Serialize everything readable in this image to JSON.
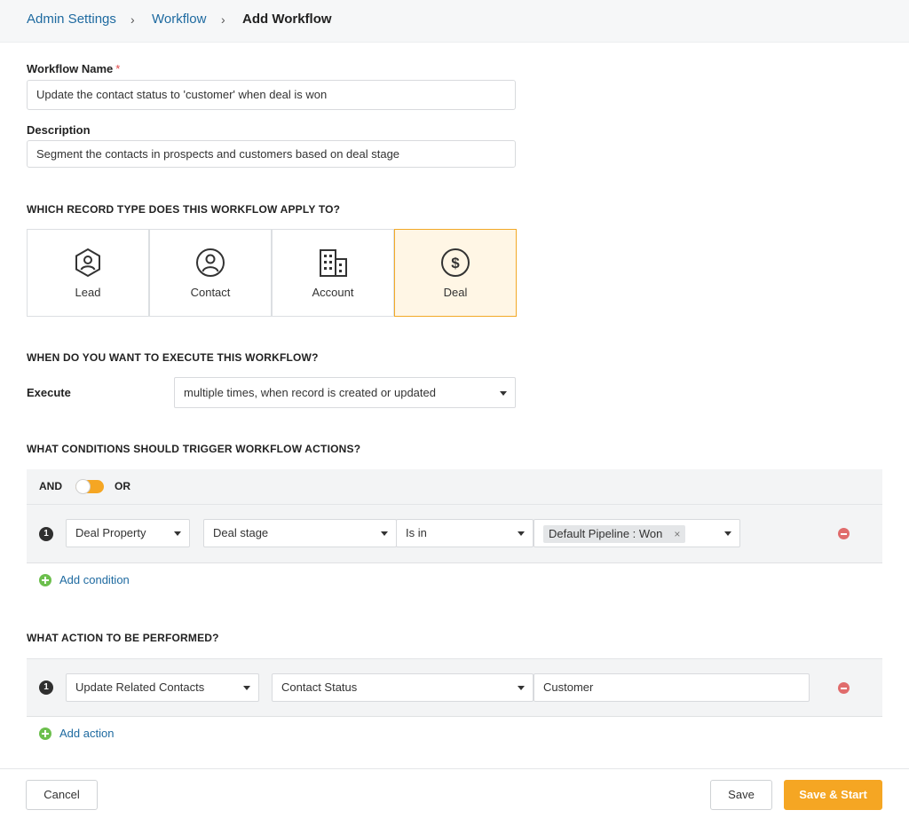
{
  "breadcrumb": {
    "items": [
      "Admin Settings",
      "Workflow",
      "Add Workflow"
    ]
  },
  "form": {
    "name_label": "Workflow Name",
    "required_mark": "*",
    "name_value": "Update the contact status to 'customer' when deal is won",
    "description_label": "Description",
    "description_value": "Segment the contacts in prospects and customers based on deal stage"
  },
  "record_type": {
    "title": "WHICH RECORD TYPE DOES THIS WORKFLOW APPLY TO?",
    "options": [
      {
        "label": "Lead",
        "icon": "lead-hexagon-user-icon"
      },
      {
        "label": "Contact",
        "icon": "contact-circle-user-icon"
      },
      {
        "label": "Account",
        "icon": "account-building-icon"
      },
      {
        "label": "Deal",
        "icon": "deal-dollar-icon"
      }
    ],
    "selected": "Deal"
  },
  "execute": {
    "title": "WHEN DO YOU WANT TO EXECUTE THIS WORKFLOW?",
    "label": "Execute",
    "value": "multiple times, when record is created or updated"
  },
  "conditions": {
    "title": "WHAT CONDITIONS SHOULD TRIGGER WORKFLOW ACTIONS?",
    "and_label": "AND",
    "or_label": "OR",
    "rows": [
      {
        "number": "1",
        "property": "Deal Property",
        "field": "Deal stage",
        "operator": "Is in",
        "value_chip": "Default Pipeline : Won",
        "chip_remove": "×"
      }
    ],
    "add_label": "Add condition"
  },
  "actions": {
    "title": "WHAT ACTION TO BE PERFORMED?",
    "rows": [
      {
        "number": "1",
        "action": "Update Related Contacts",
        "field": "Contact Status",
        "value": "Customer"
      }
    ],
    "add_label": "Add action"
  },
  "footer": {
    "cancel_label": "Cancel",
    "save_label": "Save",
    "save_start_label": "Save & Start"
  },
  "colors": {
    "accent": "#f5a623",
    "link": "#1e6aa0",
    "remove": "#e06c6c",
    "add": "#6cbf4d",
    "selected_bg": "#fff6e5"
  }
}
